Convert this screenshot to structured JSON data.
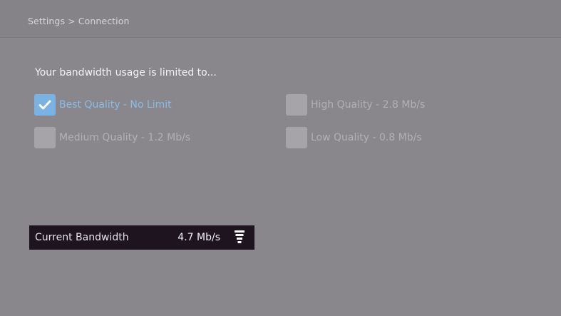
{
  "header": {
    "breadcrumb": "Settings > Connection"
  },
  "main": {
    "prompt": "Your bandwidth usage is limited to...",
    "options": [
      {
        "label": "Best Quality - No Limit",
        "checked": true
      },
      {
        "label": "High Quality - 2.8 Mb/s",
        "checked": false
      },
      {
        "label": "Medium Quality - 1.2 Mb/s",
        "checked": false
      },
      {
        "label": "Low Quality - 0.8 Mb/s",
        "checked": false
      }
    ],
    "bandwidth": {
      "label": "Current Bandwidth",
      "value": "4.7 Mb/s",
      "icon": "signal-strength-icon"
    }
  },
  "colors": {
    "background": "#8a878c",
    "accent": "#79b2e3",
    "bar": "#1d1420"
  }
}
